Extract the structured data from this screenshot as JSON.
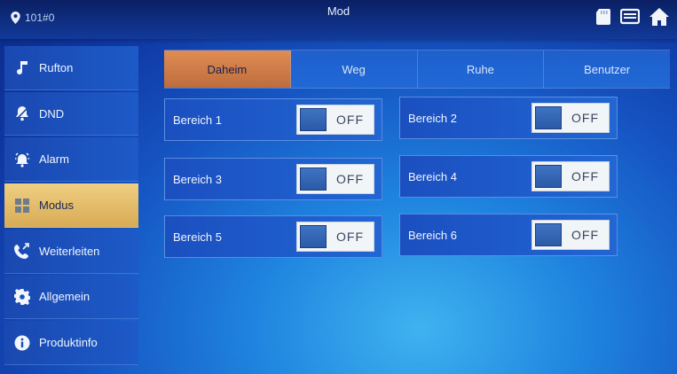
{
  "header": {
    "location": "101#0",
    "title": "Mod"
  },
  "icons": {
    "location": "location-pin-icon",
    "sd_card": "sd-card-icon",
    "messages": "message-icon",
    "home": "home-icon"
  },
  "sidebar": {
    "items": [
      {
        "label": "Rufton",
        "icon": "music-note-icon",
        "active": false
      },
      {
        "label": "DND",
        "icon": "bell-icon",
        "active": false
      },
      {
        "label": "Alarm",
        "icon": "alarm-icon",
        "active": false
      },
      {
        "label": "Modus",
        "icon": "grid-icon",
        "active": true
      },
      {
        "label": "Weiterleiten",
        "icon": "call-forward-icon",
        "active": false
      },
      {
        "label": "Allgemein",
        "icon": "gear-icon",
        "active": false
      },
      {
        "label": "Produktinfo",
        "icon": "info-icon",
        "active": false
      }
    ]
  },
  "tabs": [
    {
      "label": "Daheim",
      "active": true
    },
    {
      "label": "Weg",
      "active": false
    },
    {
      "label": "Ruhe",
      "active": false
    },
    {
      "label": "Benutzer",
      "active": false
    }
  ],
  "zones": [
    {
      "label": "Bereich 1",
      "state": "OFF"
    },
    {
      "label": "Bereich 2",
      "state": "OFF"
    },
    {
      "label": "Bereich 3",
      "state": "OFF"
    },
    {
      "label": "Bereich 4",
      "state": "OFF"
    },
    {
      "label": "Bereich 5",
      "state": "OFF"
    },
    {
      "label": "Bereich 6",
      "state": "OFF"
    }
  ],
  "colors": {
    "active_sidebar": "#e6c06f",
    "active_tab": "#d27c48",
    "background": "#1656c4"
  }
}
